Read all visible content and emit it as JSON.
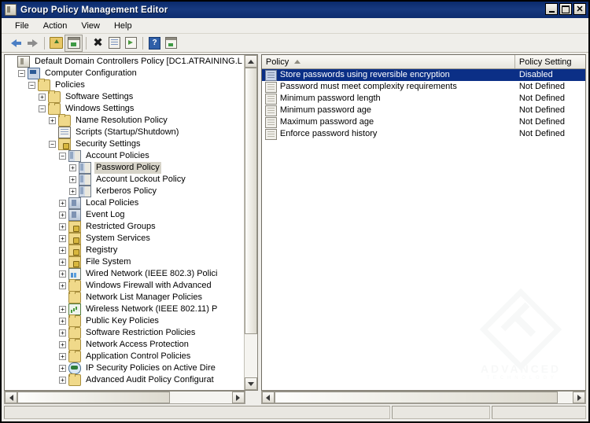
{
  "window": {
    "title": "Group Policy Management Editor",
    "icon": "gpo-icon",
    "buttons": {
      "minimize": "–",
      "maximize": "□",
      "close": "✕"
    }
  },
  "menubar": {
    "items": [
      {
        "label": "File"
      },
      {
        "label": "Action"
      },
      {
        "label": "View"
      },
      {
        "label": "Help"
      }
    ]
  },
  "toolbar": {
    "items": [
      {
        "name": "back-icon",
        "label": "Back"
      },
      {
        "name": "forward-icon",
        "label": "Forward"
      },
      {
        "name": "up-one-level-icon",
        "label": "Up One Level"
      },
      {
        "name": "show-hide-console-tree-icon",
        "label": "Show/Hide Console Tree"
      },
      {
        "name": "delete-icon",
        "label": "Delete"
      },
      {
        "name": "properties-icon",
        "label": "Properties"
      },
      {
        "name": "export-list-icon",
        "label": "Export List"
      },
      {
        "name": "help-icon",
        "label": "Help"
      },
      {
        "name": "show-hide-action-pane-icon",
        "label": "Show/Hide Action Pane"
      }
    ]
  },
  "tree": {
    "nodes": [
      {
        "label": "Default Domain Controllers Policy [DC1.ATRAINING.L",
        "indent": 0,
        "expander": "none",
        "icon": "i-gpo",
        "name": "tree-item-default-domain-controllers-policy",
        "selected": false
      },
      {
        "label": "Computer Configuration",
        "indent": 1,
        "expander": "−",
        "icon": "i-comp",
        "name": "tree-item-computer-configuration",
        "selected": false
      },
      {
        "label": "Policies",
        "indent": 2,
        "expander": "−",
        "icon": "i-folder",
        "name": "tree-item-policies",
        "selected": false
      },
      {
        "label": "Software Settings",
        "indent": 3,
        "expander": "+",
        "icon": "i-folder",
        "name": "tree-item-software-settings",
        "selected": false
      },
      {
        "label": "Windows Settings",
        "indent": 3,
        "expander": "−",
        "icon": "i-folder",
        "name": "tree-item-windows-settings",
        "selected": false
      },
      {
        "label": "Name Resolution Policy",
        "indent": 4,
        "expander": "+",
        "icon": "i-folder",
        "name": "tree-item-name-resolution-policy",
        "selected": false
      },
      {
        "label": "Scripts (Startup/Shutdown)",
        "indent": 4,
        "expander": "none",
        "icon": "i-script",
        "name": "tree-item-scripts-startup-shutdown",
        "selected": false
      },
      {
        "label": "Security Settings",
        "indent": 4,
        "expander": "−",
        "icon": "i-lock",
        "name": "tree-item-security-settings",
        "selected": false
      },
      {
        "label": "Account Policies",
        "indent": 5,
        "expander": "−",
        "icon": "i-acct",
        "name": "tree-item-account-policies",
        "selected": false
      },
      {
        "label": "Password Policy",
        "indent": 6,
        "expander": "+",
        "icon": "i-acct",
        "name": "tree-item-password-policy",
        "selected": true
      },
      {
        "label": "Account Lockout Policy",
        "indent": 6,
        "expander": "+",
        "icon": "i-acct",
        "name": "tree-item-account-lockout-policy",
        "selected": false
      },
      {
        "label": "Kerberos Policy",
        "indent": 6,
        "expander": "+",
        "icon": "i-acct",
        "name": "tree-item-kerberos-policy",
        "selected": false
      },
      {
        "label": "Local Policies",
        "indent": 5,
        "expander": "+",
        "icon": "i-localpol",
        "name": "tree-item-local-policies",
        "selected": false
      },
      {
        "label": "Event Log",
        "indent": 5,
        "expander": "+",
        "icon": "i-localpol",
        "name": "tree-item-event-log",
        "selected": false
      },
      {
        "label": "Restricted Groups",
        "indent": 5,
        "expander": "+",
        "icon": "i-lock",
        "name": "tree-item-restricted-groups",
        "selected": false
      },
      {
        "label": "System Services",
        "indent": 5,
        "expander": "+",
        "icon": "i-lock",
        "name": "tree-item-system-services",
        "selected": false
      },
      {
        "label": "Registry",
        "indent": 5,
        "expander": "+",
        "icon": "i-lock",
        "name": "tree-item-registry",
        "selected": false
      },
      {
        "label": "File System",
        "indent": 5,
        "expander": "+",
        "icon": "i-lock",
        "name": "tree-item-file-system",
        "selected": false
      },
      {
        "label": "Wired Network (IEEE 802.3) Polici",
        "indent": 5,
        "expander": "+",
        "icon": "i-net",
        "name": "tree-item-wired-network-policies",
        "selected": false
      },
      {
        "label": "Windows Firewall with Advanced",
        "indent": 5,
        "expander": "+",
        "icon": "i-folder",
        "name": "tree-item-windows-firewall",
        "selected": false
      },
      {
        "label": "Network List Manager Policies",
        "indent": 5,
        "expander": "none",
        "icon": "i-folder",
        "name": "tree-item-network-list-manager-policies",
        "selected": false
      },
      {
        "label": "Wireless Network (IEEE 802.11) P",
        "indent": 5,
        "expander": "+",
        "icon": "i-wifi",
        "name": "tree-item-wireless-network-policies",
        "selected": false
      },
      {
        "label": "Public Key Policies",
        "indent": 5,
        "expander": "+",
        "icon": "i-folder",
        "name": "tree-item-public-key-policies",
        "selected": false
      },
      {
        "label": "Software Restriction Policies",
        "indent": 5,
        "expander": "+",
        "icon": "i-folder",
        "name": "tree-item-software-restriction-policies",
        "selected": false
      },
      {
        "label": "Network Access Protection",
        "indent": 5,
        "expander": "+",
        "icon": "i-folder",
        "name": "tree-item-network-access-protection",
        "selected": false
      },
      {
        "label": "Application Control Policies",
        "indent": 5,
        "expander": "+",
        "icon": "i-folder",
        "name": "tree-item-application-control-policies",
        "selected": false
      },
      {
        "label": "IP Security Policies on Active Dire",
        "indent": 5,
        "expander": "+",
        "icon": "i-ipsec",
        "name": "tree-item-ip-security-policies",
        "selected": false
      },
      {
        "label": "Advanced Audit Policy Configurat",
        "indent": 5,
        "expander": "+",
        "icon": "i-folder",
        "name": "tree-item-advanced-audit-policy-configuration",
        "selected": false
      }
    ]
  },
  "list": {
    "columns": [
      {
        "label": "Policy",
        "sort": "ascending"
      },
      {
        "label": "Policy Setting",
        "sort": "none"
      }
    ],
    "rows": [
      {
        "policy": "Enforce password history",
        "setting": "Not Defined",
        "selected": false,
        "name": "list-row-enforce-password-history"
      },
      {
        "policy": "Maximum password age",
        "setting": "Not Defined",
        "selected": false,
        "name": "list-row-maximum-password-age"
      },
      {
        "policy": "Minimum password age",
        "setting": "Not Defined",
        "selected": false,
        "name": "list-row-minimum-password-age"
      },
      {
        "policy": "Minimum password length",
        "setting": "Not Defined",
        "selected": false,
        "name": "list-row-minimum-password-length"
      },
      {
        "policy": "Password must meet complexity requirements",
        "setting": "Not Defined",
        "selected": false,
        "name": "list-row-password-complexity"
      },
      {
        "policy": "Store passwords using reversible encryption",
        "setting": "Disabled",
        "selected": true,
        "name": "list-row-store-passwords-reversible-encryption"
      }
    ]
  },
  "watermark": {
    "text": "ADVANCED",
    "subtext": "T E C H N O L O G Y"
  },
  "statusbar": {
    "pane1": "",
    "pane2": "",
    "pane3": ""
  },
  "colors": {
    "title_bar": "#0d2c6e",
    "selection": "#0b2f86",
    "tree_selection": "#d6d3c8",
    "window_face": "#efeeea"
  }
}
